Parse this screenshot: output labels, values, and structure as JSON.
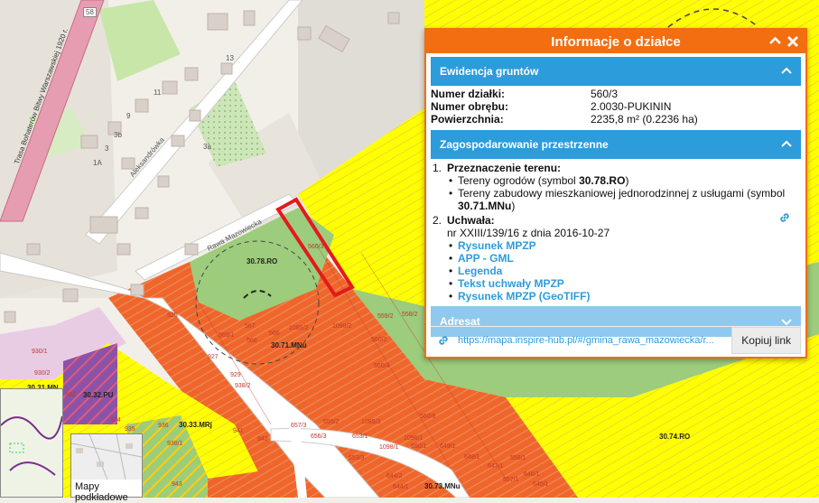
{
  "popup": {
    "title": "Informacje o działce",
    "collapse_icon": "chevrons-up-icon",
    "close_icon": "close-icon",
    "sections": {
      "ewidencja": {
        "title": "Ewidencja gruntów",
        "rows": [
          {
            "label": "Numer działki:",
            "value": "560/3"
          },
          {
            "label": "Numer obrębu:",
            "value": "2.0030-PUKININ"
          },
          {
            "label": "Powierzchnia:",
            "value": "2235,8 m² (0.2236 ha)"
          }
        ]
      },
      "zagospodarowanie": {
        "title": "Zagospodarowanie przestrzenne",
        "item1_num": "1.",
        "item1_title": "Przeznaczenie terenu:",
        "bullet1_pre": "Tereny ogrodów (symbol ",
        "bullet1_sym": "30.78.RO",
        "bullet1_post": ")",
        "bullet2_pre": "Tereny zabudowy mieszkaniowej jednorodzinnej z usługami (symbol",
        "bullet2_sym": "30.71.MNu",
        "bullet2_post": ")",
        "item2_num": "2.",
        "item2_title": "Uchwała:",
        "uchwala_text": "nr XXIII/139/16 z dnia 2016-10-27",
        "links": [
          "Rysunek MPZP",
          "APP - GML",
          "Legenda",
          "Tekst uchwały MPZP",
          "Rysunek MPZP (GeoTIFF)"
        ]
      },
      "adresat": {
        "title": "Adresat"
      }
    },
    "share": {
      "url": "https://mapa.inspire-hub.pl/#/gmina_rawa_mazowiecka/r...",
      "copy_label": "Kopiuj link"
    }
  },
  "map": {
    "zones": [
      "30.78.RO",
      "30.71.MNu",
      "30.32.PU",
      "30.33.MRj",
      "30.74.RO",
      "30.73.MNu",
      "30.31.MN"
    ],
    "selected_parcel": "560/3",
    "roads": [
      "Trasa Bohaterów Bitwy Warszawskiej 1920 r.",
      "Aleksandrówka",
      "Rawa Mazowiecka",
      "58"
    ],
    "building_numbers": [
      "13",
      "11",
      "9",
      "3b",
      "3",
      "1A",
      "3a"
    ],
    "parcel_numbers": [
      "925",
      "567",
      "568",
      "566",
      "569/1",
      "1085/2",
      "1098/2",
      "927",
      "929",
      "938/2",
      "930/2",
      "930/1",
      "932",
      "934",
      "935",
      "936",
      "938/1",
      "941",
      "942",
      "943",
      "657/3",
      "655/2",
      "1085/3",
      "653/1",
      "656/3",
      "653/3",
      "650/1",
      "649/1",
      "648/1",
      "647/1",
      "646/1",
      "645/1",
      "644/2",
      "644/1",
      "559/2",
      "558/2",
      "560/2",
      "560/6",
      "560/4",
      "558/1",
      "557/1",
      "1096/1",
      "1098/1"
    ],
    "thumb_label": "Mapy podkładowe"
  },
  "colors": {
    "accent": "#f36e10",
    "section": "#2d9cdb",
    "zone_yellow": "#ffff00",
    "zone_orange": "#f0662a",
    "zone_green": "#9ccc7c",
    "selection": "#e31a1c"
  }
}
